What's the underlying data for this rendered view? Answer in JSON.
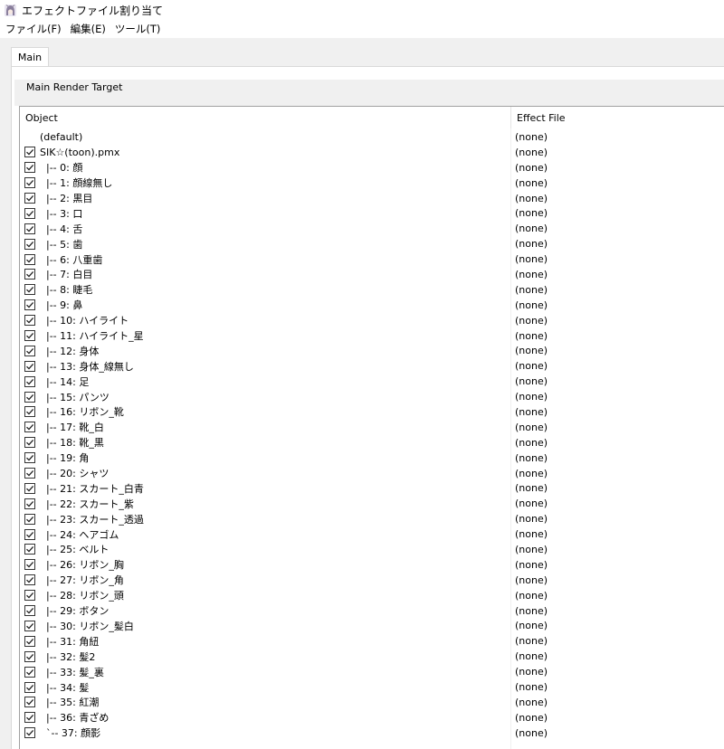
{
  "window": {
    "title": "エフェクトファイル割り当て",
    "icon": "character-avatar-icon"
  },
  "menu": [
    {
      "label": "ファイル(F)"
    },
    {
      "label": "編集(E)"
    },
    {
      "label": "ツール(T)"
    }
  ],
  "tabs": [
    {
      "label": "Main",
      "selected": true
    }
  ],
  "group": {
    "label": "Main Render Target"
  },
  "table": {
    "columns": [
      "Object",
      "Effect File"
    ],
    "rows": [
      {
        "object": "(default)",
        "effect": "(none)",
        "checkbox": false
      },
      {
        "object": "SIK☆(toon).pmx",
        "effect": "(none)",
        "checkbox": true
      },
      {
        "object": "  |-- 0: 顔",
        "effect": "(none)",
        "checkbox": true
      },
      {
        "object": "  |-- 1: 顔線無し",
        "effect": "(none)",
        "checkbox": true
      },
      {
        "object": "  |-- 2: 黒目",
        "effect": "(none)",
        "checkbox": true
      },
      {
        "object": "  |-- 3: 口",
        "effect": "(none)",
        "checkbox": true
      },
      {
        "object": "  |-- 4: 舌",
        "effect": "(none)",
        "checkbox": true
      },
      {
        "object": "  |-- 5: 歯",
        "effect": "(none)",
        "checkbox": true
      },
      {
        "object": "  |-- 6: 八重歯",
        "effect": "(none)",
        "checkbox": true
      },
      {
        "object": "  |-- 7: 白目",
        "effect": "(none)",
        "checkbox": true
      },
      {
        "object": "  |-- 8: 睫毛",
        "effect": "(none)",
        "checkbox": true
      },
      {
        "object": "  |-- 9: 鼻",
        "effect": "(none)",
        "checkbox": true
      },
      {
        "object": "  |-- 10: ハイライト",
        "effect": "(none)",
        "checkbox": true
      },
      {
        "object": "  |-- 11: ハイライト_星",
        "effect": "(none)",
        "checkbox": true
      },
      {
        "object": "  |-- 12: 身体",
        "effect": "(none)",
        "checkbox": true
      },
      {
        "object": "  |-- 13: 身体_線無し",
        "effect": "(none)",
        "checkbox": true
      },
      {
        "object": "  |-- 14: 足",
        "effect": "(none)",
        "checkbox": true
      },
      {
        "object": "  |-- 15: パンツ",
        "effect": "(none)",
        "checkbox": true
      },
      {
        "object": "  |-- 16: リボン_靴",
        "effect": "(none)",
        "checkbox": true
      },
      {
        "object": "  |-- 17: 靴_白",
        "effect": "(none)",
        "checkbox": true
      },
      {
        "object": "  |-- 18: 靴_黒",
        "effect": "(none)",
        "checkbox": true
      },
      {
        "object": "  |-- 19: 角",
        "effect": "(none)",
        "checkbox": true
      },
      {
        "object": "  |-- 20: シャツ",
        "effect": "(none)",
        "checkbox": true
      },
      {
        "object": "  |-- 21: スカート_白青",
        "effect": "(none)",
        "checkbox": true
      },
      {
        "object": "  |-- 22: スカート_紫",
        "effect": "(none)",
        "checkbox": true
      },
      {
        "object": "  |-- 23: スカート_透過",
        "effect": "(none)",
        "checkbox": true
      },
      {
        "object": "  |-- 24: ヘアゴム",
        "effect": "(none)",
        "checkbox": true
      },
      {
        "object": "  |-- 25: ベルト",
        "effect": "(none)",
        "checkbox": true
      },
      {
        "object": "  |-- 26: リボン_胸",
        "effect": "(none)",
        "checkbox": true
      },
      {
        "object": "  |-- 27: リボン_角",
        "effect": "(none)",
        "checkbox": true
      },
      {
        "object": "  |-- 28: リボン_頭",
        "effect": "(none)",
        "checkbox": true
      },
      {
        "object": "  |-- 29: ボタン",
        "effect": "(none)",
        "checkbox": true
      },
      {
        "object": "  |-- 30: リボン_髪白",
        "effect": "(none)",
        "checkbox": true
      },
      {
        "object": "  |-- 31: 角紐",
        "effect": "(none)",
        "checkbox": true
      },
      {
        "object": "  |-- 32: 髪2",
        "effect": "(none)",
        "checkbox": true
      },
      {
        "object": "  |-- 33: 髪_裏",
        "effect": "(none)",
        "checkbox": true
      },
      {
        "object": "  |-- 34: 髪",
        "effect": "(none)",
        "checkbox": true
      },
      {
        "object": "  |-- 35: 紅潮",
        "effect": "(none)",
        "checkbox": true
      },
      {
        "object": "  |-- 36: 青ざめ",
        "effect": "(none)",
        "checkbox": true
      },
      {
        "object": "  `-- 37: 顔影",
        "effect": "(none)",
        "checkbox": true
      }
    ]
  }
}
